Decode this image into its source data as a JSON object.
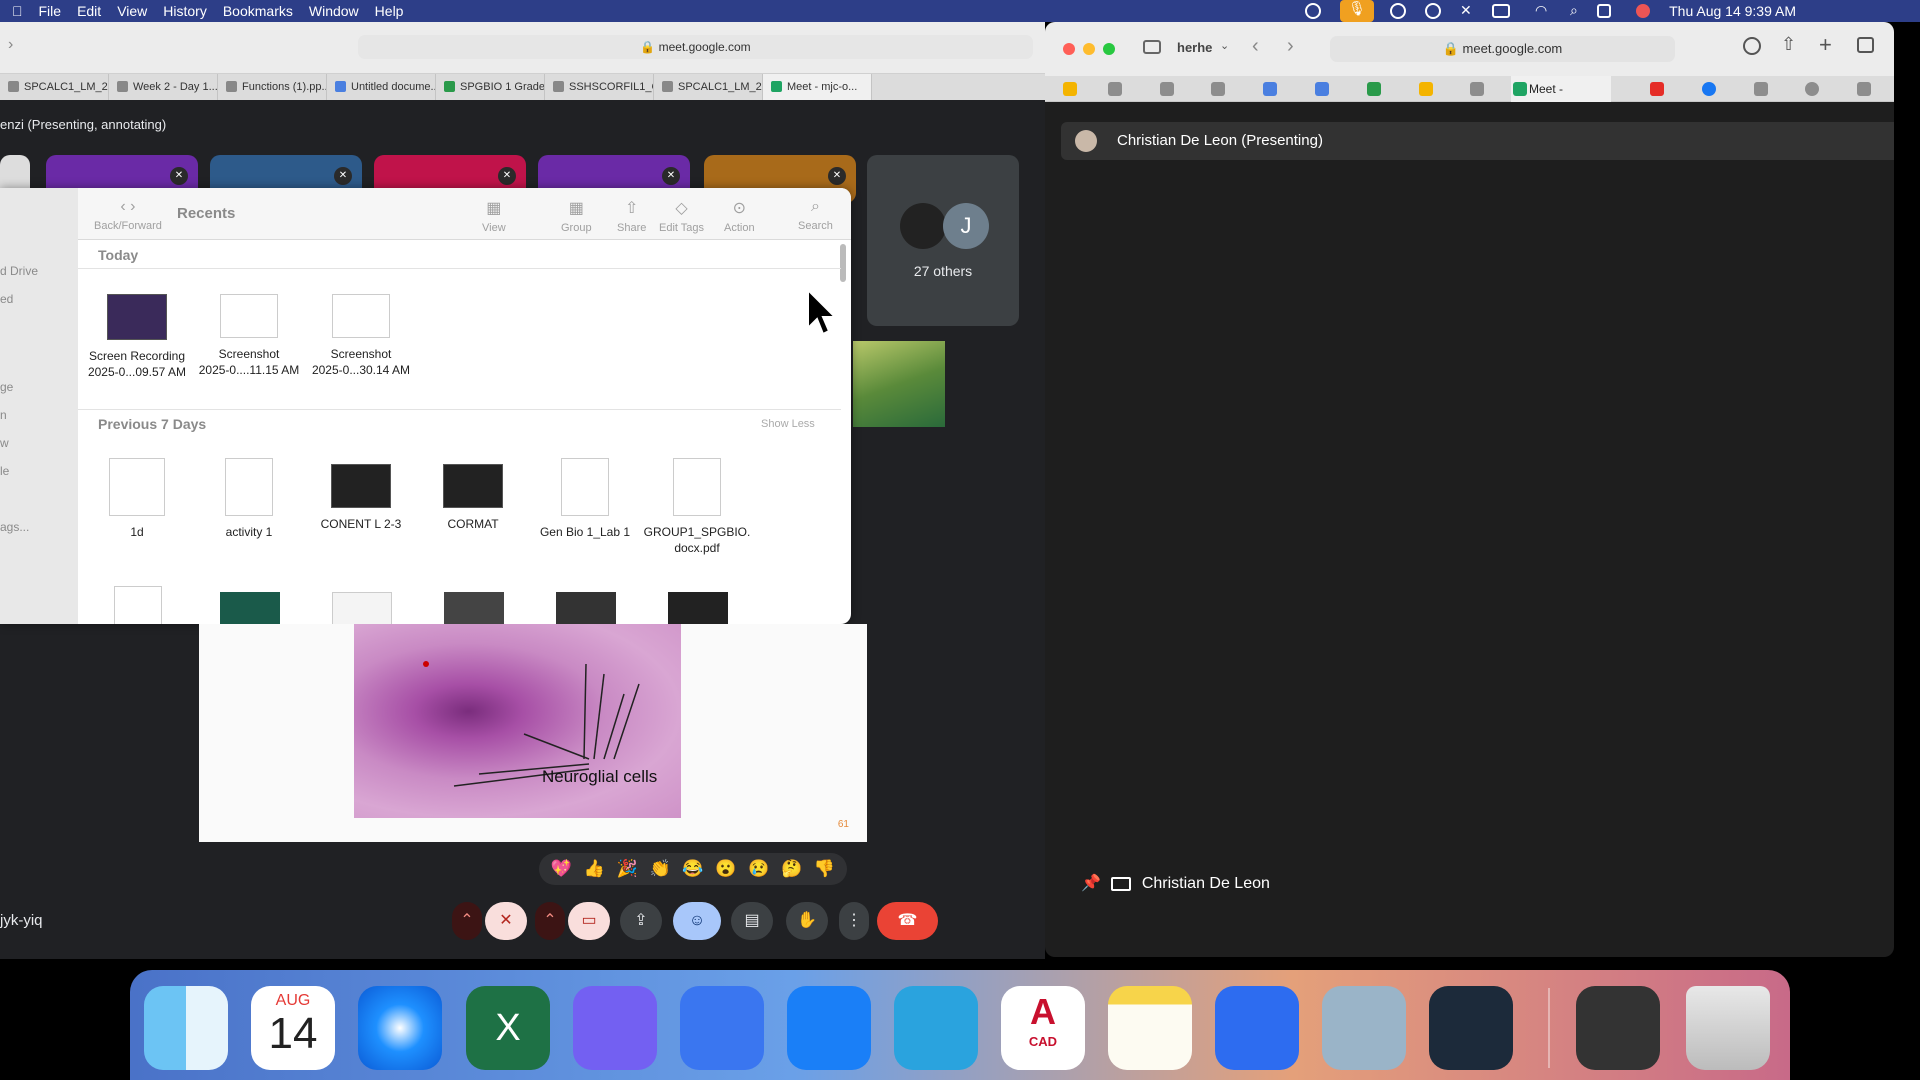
{
  "menubar": {
    "apple": "",
    "items": [
      "File",
      "Edit",
      "View",
      "History",
      "Bookmarks",
      "Window",
      "Help"
    ],
    "clock": "Thu Aug 14  9:39 AM"
  },
  "left_browser": {
    "url": "meet.google.com",
    "tabs": [
      "SPCALC1_LM_2...",
      "Week 2 - Day 1...",
      "Functions (1).pp...",
      "Untitled docume...",
      "SPGBIO 1 Grade...",
      "SSHSCORFIL1_C...",
      "SPCALC1_LM_2...",
      "Meet - mjc-o..."
    ],
    "presenting_label": "enzi (Presenting, annotating)",
    "others_count": "27 others",
    "others_initial": "J",
    "meeting_code": "jyk-yiq"
  },
  "finder": {
    "title": "Recents",
    "nav_label": "Back/Forward",
    "toolbar": [
      "View",
      "Group",
      "Share",
      "Edit Tags",
      "Action",
      "Search"
    ],
    "sidebar": [
      "d Drive",
      "ed",
      "ge",
      "n",
      "w",
      "le",
      "ags..."
    ],
    "section_today": "Today",
    "today_files": [
      {
        "name": "Screen Recording",
        "sub": "2025-0...09.57 AM"
      },
      {
        "name": "Screenshot",
        "sub": "2025-0....11.15 AM"
      },
      {
        "name": "Screenshot",
        "sub": "2025-0...30.14 AM"
      }
    ],
    "section_week": "Previous 7 Days",
    "show_less": "Show Less",
    "week_files": [
      {
        "name": "1d",
        "sub": ""
      },
      {
        "name": "activity 1",
        "sub": ""
      },
      {
        "name": "CONENT L 2-3",
        "sub": ""
      },
      {
        "name": "CORMAT",
        "sub": ""
      },
      {
        "name": "Gen Bio 1_Lab 1",
        "sub": ""
      },
      {
        "name": "GROUP1_SPGBIO.",
        "sub": "docx.pdf"
      }
    ]
  },
  "slide": {
    "label": "Neuroglial cells",
    "page": "61"
  },
  "reactions": [
    "💖",
    "👍",
    "🎉",
    "👏",
    "😂",
    "😮",
    "😢",
    "🤔",
    "👎"
  ],
  "right_window": {
    "profile": "herhe",
    "url": "meet.google.com",
    "tab_meet": "Meet -",
    "presenting": "Christian De Leon (Presenting)",
    "pinned_name": "Christian De Leon"
  },
  "dock": {
    "calendar_month": "AUG",
    "calendar_day": "14",
    "cad_label": "CAD",
    "cad_letter": "A"
  },
  "colors": {
    "menubar": "#2d3e88",
    "end_call": "#ea4335",
    "reaction_active": "#a8c7fa"
  }
}
